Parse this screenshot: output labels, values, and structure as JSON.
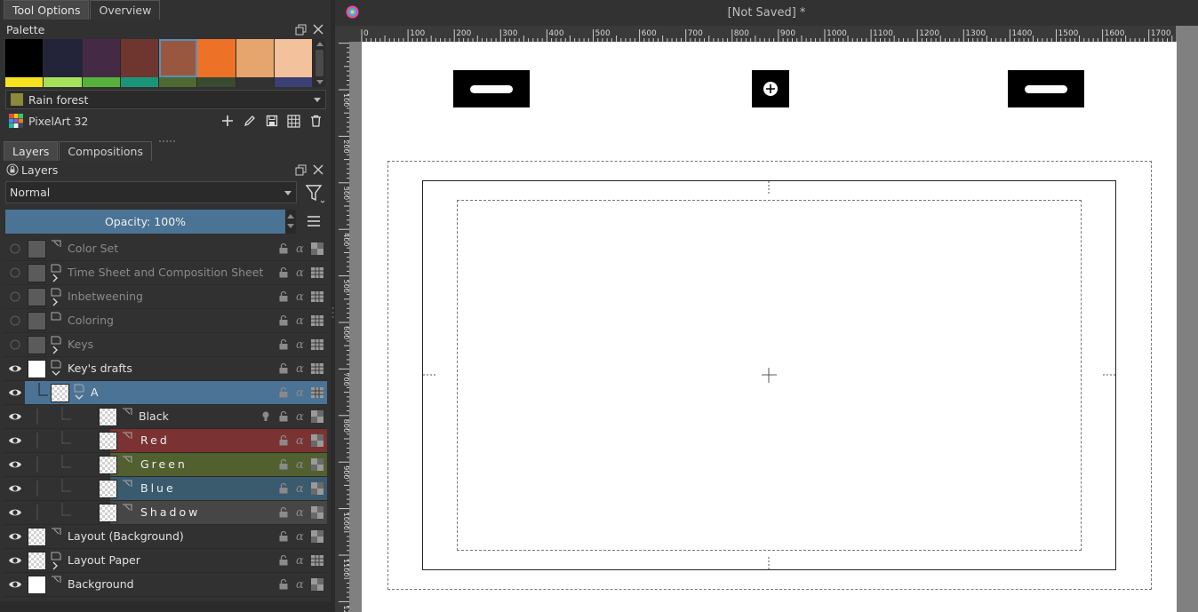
{
  "tool_tabs": [
    "Tool Options",
    "Overview"
  ],
  "palette": {
    "title": "Palette",
    "swatches_top": [
      "#000000",
      "#23243a",
      "#452a45",
      "#6e362f",
      "#9a5740",
      "#ed7227",
      "#e6a56c",
      "#f4c19d"
    ],
    "swatches_bottom": [
      "#f6e21d",
      "#a5e25a",
      "#56b23b",
      "#1b957a",
      "#4e6a32",
      "#3a4a30",
      "#323232",
      "#3c3f73"
    ],
    "selected_index": 4,
    "group_name": "Rain forest",
    "group_color": "#8a8a3a",
    "palette_name": "PixelArt 32"
  },
  "layer_tabs": [
    "Layers",
    "Compositions"
  ],
  "layers_panel": {
    "title": "Layers",
    "blend_mode": "Normal",
    "opacity_label": "Opacity:  100%"
  },
  "layers": [
    {
      "name": "Color Set",
      "depth": 0,
      "visible": false,
      "thumb": "gray",
      "type": "paint",
      "expander": "",
      "color": "",
      "selected": false,
      "spaced": false
    },
    {
      "name": "Time Sheet and Composition Sheet",
      "depth": 0,
      "visible": false,
      "thumb": "gray",
      "type": "group",
      "expander": ">",
      "color": "",
      "selected": false,
      "spaced": false
    },
    {
      "name": "Inbetweening",
      "depth": 0,
      "visible": false,
      "thumb": "gray",
      "type": "group",
      "expander": ">",
      "color": "",
      "selected": false,
      "spaced": false
    },
    {
      "name": "Coloring",
      "depth": 0,
      "visible": false,
      "thumb": "gray",
      "type": "group",
      "expander": "",
      "color": "",
      "selected": false,
      "spaced": false
    },
    {
      "name": "Keys",
      "depth": 0,
      "visible": false,
      "thumb": "gray",
      "type": "group",
      "expander": ">",
      "color": "",
      "selected": false,
      "spaced": false
    },
    {
      "name": "Key's drafts",
      "depth": 0,
      "visible": true,
      "thumb": "white",
      "type": "group",
      "expander": "v",
      "color": "",
      "selected": false,
      "spaced": false
    },
    {
      "name": "A",
      "depth": 1,
      "visible": true,
      "thumb": "checker",
      "type": "group",
      "expander": "v",
      "color": "#4b7395",
      "selected": true,
      "spaced": false
    },
    {
      "name": "Black",
      "depth": 2,
      "visible": true,
      "thumb": "checker",
      "type": "paint",
      "expander": "",
      "color": "",
      "selected": false,
      "spaced": false
    },
    {
      "name": "Red",
      "depth": 2,
      "visible": true,
      "thumb": "checker",
      "type": "paint",
      "expander": "",
      "color": "#7a3332",
      "selected": false,
      "spaced": true
    },
    {
      "name": "Green",
      "depth": 2,
      "visible": true,
      "thumb": "checker",
      "type": "paint",
      "expander": "",
      "color": "#52602f",
      "selected": false,
      "spaced": true
    },
    {
      "name": "Blue",
      "depth": 2,
      "visible": true,
      "thumb": "checker",
      "type": "paint",
      "expander": "",
      "color": "#3a5a6e",
      "selected": false,
      "spaced": true
    },
    {
      "name": "Shadow",
      "depth": 2,
      "visible": true,
      "thumb": "checker",
      "type": "paint",
      "expander": "",
      "color": "#464646",
      "selected": false,
      "spaced": true
    },
    {
      "name": "Layout (Background)",
      "depth": 0,
      "visible": true,
      "thumb": "checker",
      "type": "paint",
      "expander": "",
      "color": "",
      "selected": false,
      "spaced": false
    },
    {
      "name": "Layout Paper",
      "depth": 0,
      "visible": true,
      "thumb": "checker",
      "type": "group",
      "expander": ">",
      "color": "",
      "selected": false,
      "spaced": false
    },
    {
      "name": "Background",
      "depth": 0,
      "visible": true,
      "thumb": "white",
      "type": "paint",
      "expander": "",
      "color": "",
      "selected": false,
      "spaced": false
    }
  ],
  "document": {
    "title": "[Not Saved]  *",
    "ruler_h_labels": [
      "0",
      "100",
      "200",
      "300",
      "400",
      "500",
      "600",
      "700",
      "800",
      "900",
      "1000",
      "1100",
      "1200",
      "1300",
      "1400",
      "1500",
      "1600",
      "1700"
    ],
    "ruler_v_labels": [
      "100",
      "200",
      "300",
      "400",
      "500",
      "600",
      "700",
      "800",
      "900",
      "1000",
      "1100",
      "1200"
    ]
  }
}
